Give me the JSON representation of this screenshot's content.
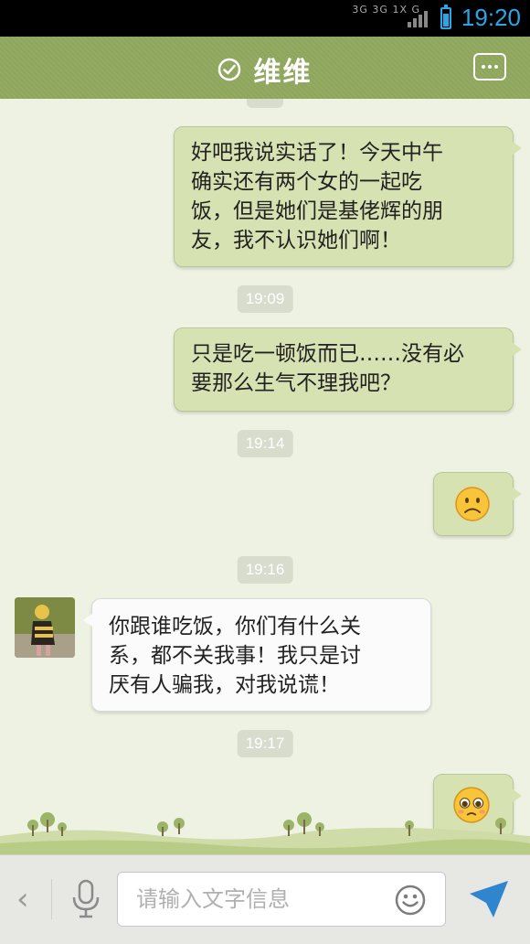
{
  "status_bar": {
    "network": "3G 3G 1X G",
    "time": "19:20"
  },
  "header": {
    "title": "维维"
  },
  "messages": [
    {
      "type": "sent",
      "text_lines": [
        "好吧我说实话了！今天中午",
        "确实还有两个女的一起吃",
        "饭，但是她们是基佬辉的朋",
        "友，我不认识她们啊！"
      ]
    },
    {
      "type": "timestamp",
      "text": "19:09"
    },
    {
      "type": "sent",
      "text_lines": [
        "只是吃一顿饭而已……没有必",
        "要那么生气不理我吧？"
      ]
    },
    {
      "type": "timestamp",
      "text": "19:14"
    },
    {
      "type": "sent_emoji",
      "emoji": "sad-face-emoji"
    },
    {
      "type": "timestamp",
      "text": "19:16"
    },
    {
      "type": "received",
      "text_lines": [
        "你跟谁吃饭，你们有什么关",
        "系，都不关我事！我只是讨",
        "厌有人骗我，对我说谎！"
      ]
    },
    {
      "type": "timestamp",
      "text": "19:17"
    },
    {
      "type": "sent_emoji",
      "emoji": "pleading-face-emoji"
    }
  ],
  "input_bar": {
    "placeholder": "请输入文字信息"
  },
  "colors": {
    "header_green": "#8ea65c",
    "sent_bubble": "#d6e2b2",
    "received_bubble": "#fbfbfb",
    "status_time": "#2aa6e8"
  }
}
